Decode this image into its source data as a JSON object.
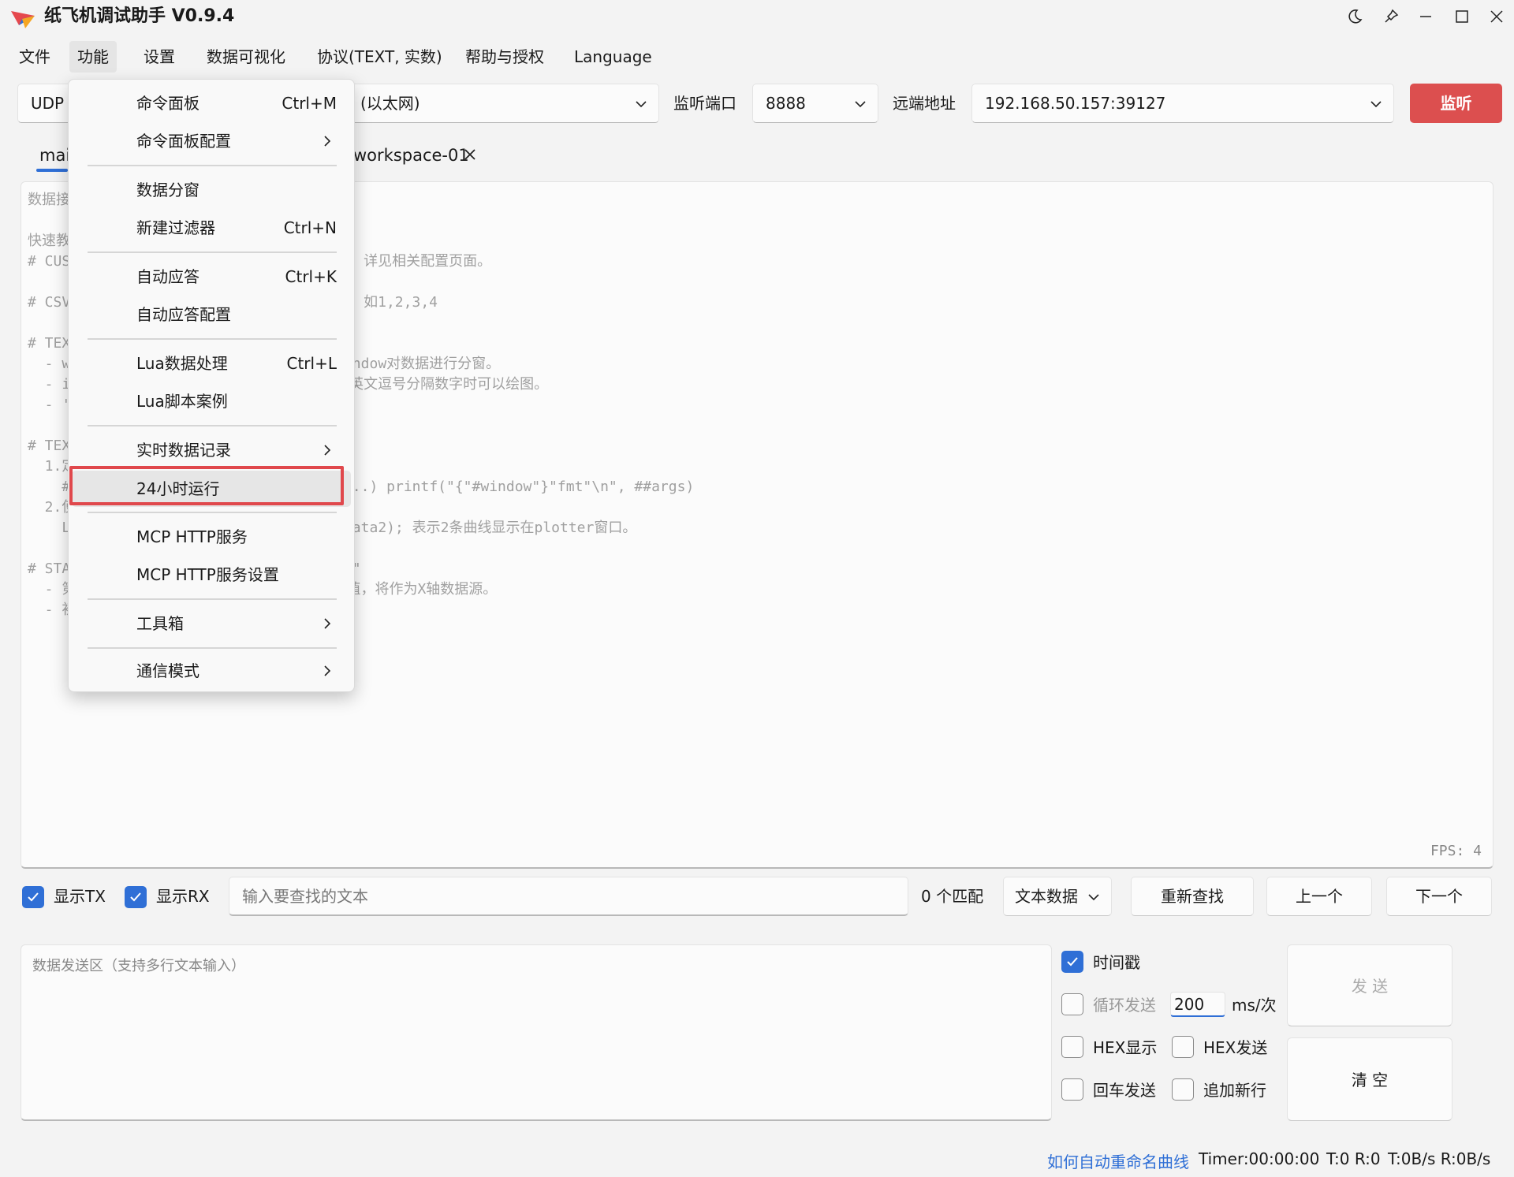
{
  "window": {
    "title": "纸飞机调试助手 V0.9.4",
    "controls": [
      "theme-toggle",
      "pin",
      "minimize",
      "maximize",
      "close"
    ]
  },
  "menubar": {
    "items": [
      "文件",
      "功能",
      "设置",
      "数据可视化",
      "协议(TEXT, 实数)",
      "帮助与授权",
      "Language"
    ],
    "active": "功能"
  },
  "toolbar": {
    "protocol": "UDP",
    "interface": "(以太网)",
    "listen_port_label": "监听端口",
    "listen_port": "8888",
    "remote_addr_label": "远端地址",
    "remote_addr": "192.168.50.157:39127",
    "listen_button": "监听"
  },
  "tabs": {
    "main_tab": "mai",
    "workspace_tab": "workspace-01"
  },
  "receive": {
    "lines": [
      "数据接",
      "",
      "快速教",
      "# CUS                               义，详见相关配置页面。",
      "",
      "# CSV                               图，如1,2,3,4",
      "",
      "# TEX",
      "  - w                               window对数据进行分窗。",
      "  - i                               为英文逗号分隔数字时可以绘图。",
      "  - '",
      "",
      "# TEX",
      "  1.定",
      "    #                               s...) printf(\"{\"#window\"}\"fmt\"\\n\", ##args)",
      "  2.使",
      "    L                                data2); 表示2条曲线显示在plotter窗口。",
      "",
      "# STA                               \\n\"",
      "  - 第                              数值，将作为X轴数据源。",
      "  - 初"
    ],
    "fps": "FPS: 4"
  },
  "search_bar": {
    "show_tx_label": "显示TX",
    "show_tx": true,
    "show_rx_label": "显示RX",
    "show_rx": true,
    "placeholder": "输入要查找的文本",
    "match_count": "0 个匹配",
    "mode": "文本数据",
    "refind": "重新查找",
    "prev": "上一个",
    "next": "下一个"
  },
  "send": {
    "placeholder": "数据发送区（支持多行文本输入）",
    "timestamp_label": "时间戳",
    "timestamp": true,
    "loop_label": "循环发送",
    "loop": false,
    "interval": "200",
    "interval_unit": "ms/次",
    "hex_display_label": "HEX显示",
    "hex_display": false,
    "hex_send_label": "HEX发送",
    "hex_send": false,
    "enter_send_label": "回车发送",
    "enter_send": false,
    "append_newline_label": "追加新行",
    "append_newline": false,
    "send_button": "发 送",
    "clear_button": "清 空"
  },
  "statusbar": {
    "link": "如何自动重命名曲线",
    "timer": "Timer:00:00:00",
    "counts": "T:0 R:0",
    "rates": "T:0B/s R:0B/s"
  },
  "dropdown": {
    "items": [
      {
        "label": "命令面板",
        "shortcut": "Ctrl+M"
      },
      {
        "label": "命令面板配置",
        "submenu": true
      },
      {
        "label": "数据分窗"
      },
      {
        "label": "新建过滤器",
        "shortcut": "Ctrl+N"
      },
      {
        "label": "自动应答",
        "shortcut": "Ctrl+K"
      },
      {
        "label": "自动应答配置"
      },
      {
        "label": "Lua数据处理",
        "shortcut": "Ctrl+L"
      },
      {
        "label": "Lua脚本案例"
      },
      {
        "label": "实时数据记录",
        "submenu": true
      },
      {
        "label": "24小时运行",
        "highlighted": true
      },
      {
        "label": "MCP HTTP服务"
      },
      {
        "label": "MCP HTTP服务设置"
      },
      {
        "label": "工具箱",
        "submenu": true
      },
      {
        "label": "通信模式",
        "submenu": true
      }
    ]
  },
  "colors": {
    "accent": "#2f6fd6",
    "listen_button": "#dc4f4f",
    "highlight_box": "#e0484c"
  }
}
